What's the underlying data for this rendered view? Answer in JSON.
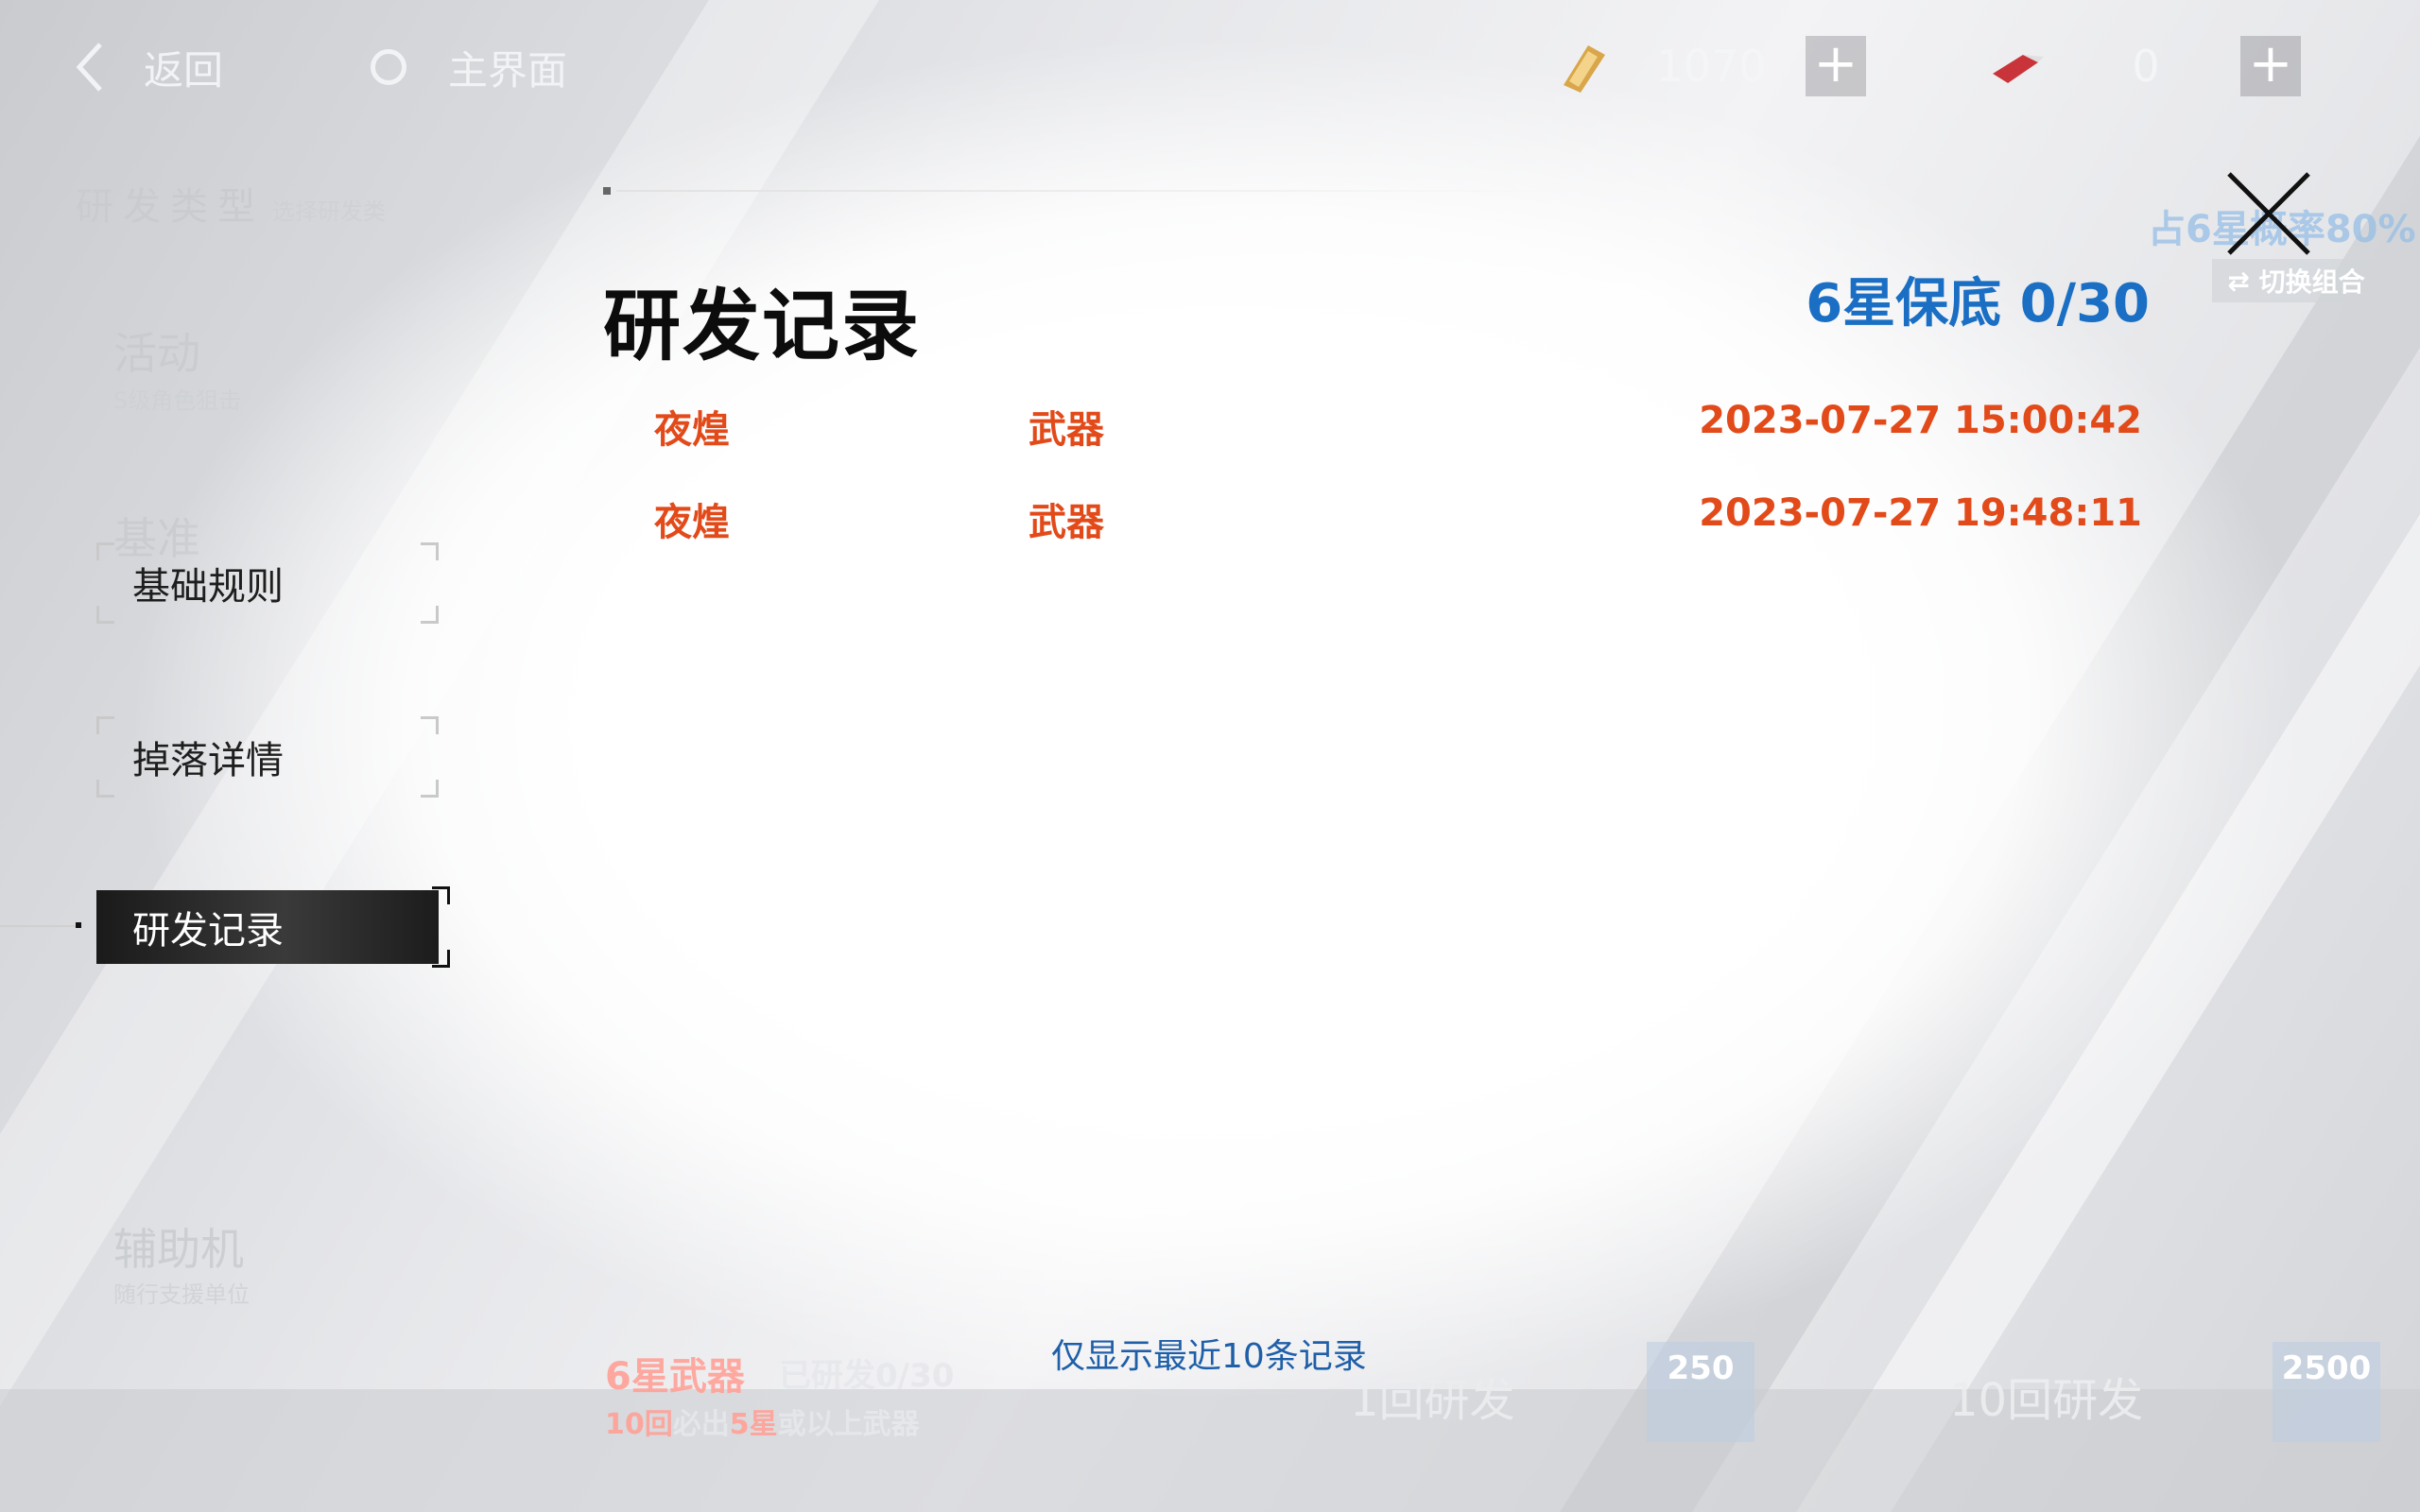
{
  "topbar": {
    "back_label": "返回",
    "home_label": "主界面",
    "currencies": [
      {
        "icon": "gold-ticket-icon",
        "value": "1070"
      },
      {
        "icon": "red-ticket-icon",
        "value": "0"
      }
    ],
    "plus_label": "+"
  },
  "sidebar": {
    "header": "研发类型",
    "header_sub": "选择研发类",
    "tabs": [
      {
        "label": "基础规则",
        "active": false
      },
      {
        "label": "掉落详情",
        "active": false
      },
      {
        "label": "研发记录",
        "active": true
      }
    ],
    "faded_items": [
      {
        "label": "活动",
        "sub": "S级角色狙击"
      },
      {
        "label": "基准",
        "sub": ""
      },
      {
        "label": "辅助机",
        "sub": "随行支援单位"
      }
    ]
  },
  "dialog": {
    "title": "研发记录",
    "pity": "6星保底 0/30",
    "close_icon": "close-icon",
    "records": [
      {
        "name": "夜煌",
        "type": "武器",
        "time": "2023-07-27 15:00:42"
      },
      {
        "name": "夜煌",
        "type": "武器",
        "time": "2023-07-27 19:48:11"
      }
    ],
    "footer_note": "仅显示最近10条记录"
  },
  "background_ui": {
    "rate_text": "占6星概率80%",
    "switch_label": "切换组合",
    "six_star_weapon": "6星武器",
    "developed": "已研发0/30",
    "guarantee_prefix": "10回",
    "guarantee_mid": "必出",
    "guarantee_star": "5星",
    "guarantee_suffix": "或以上武器",
    "single_label": "1回研发",
    "single_cost": "250",
    "ten_label": "10回研发",
    "ten_cost": "2500"
  },
  "colors": {
    "accent_blue": "#1a6fc4",
    "record_red": "#e24a1a",
    "active_tab": "#222222"
  }
}
